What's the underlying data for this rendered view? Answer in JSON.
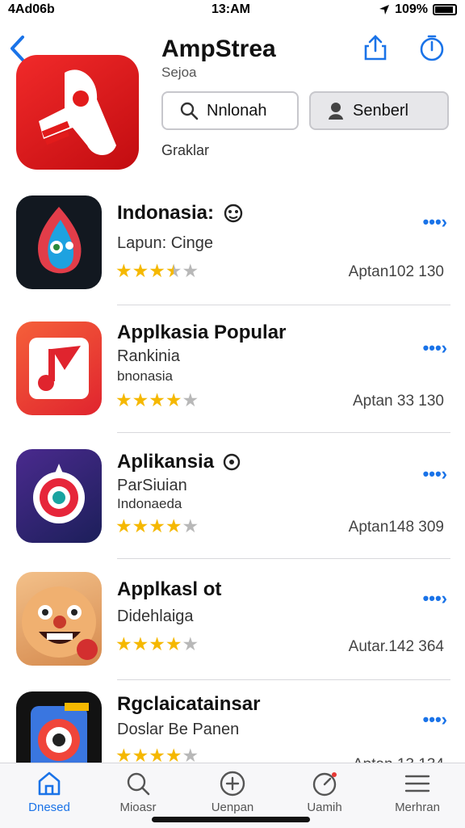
{
  "status_bar": {
    "carrier": "4Ad06b",
    "time": "13:AM",
    "battery": "109%"
  },
  "header": {
    "title": "AmpStrea",
    "subtitle": "Sejoa",
    "search_button": "Nnlonah",
    "second_button": "Senberl",
    "category": "Graklar"
  },
  "apps": [
    {
      "title": "Indonasia:",
      "line1": "Lapun: Cinge",
      "line2": "",
      "rating": 3.5,
      "count": "Aptan102 130",
      "badge": "emoji"
    },
    {
      "title": "Applkasia Popular",
      "line1": "Rankinia",
      "line2": "bnonasia",
      "rating": 4,
      "count": "Aptan 33 130",
      "badge": ""
    },
    {
      "title": "Aplikansia",
      "line1": "ParSiuian",
      "line2": "Indonaeda",
      "rating": 4,
      "count": "Aptan148 309",
      "badge": "circle"
    },
    {
      "title": "Applkasl ot",
      "line1": "Didehlaiga",
      "line2": "",
      "rating": 4,
      "count": "Autar.142 364",
      "badge": ""
    },
    {
      "title": "Rgclaicatainsar",
      "line1": "Doslar Be Panen",
      "line2": "",
      "rating": 4,
      "count": "Aptan 13 134",
      "badge": ""
    }
  ],
  "tabs": [
    {
      "label": "Dnesed",
      "icon": "home-icon",
      "active": true
    },
    {
      "label": "Mioasr",
      "icon": "search-icon",
      "active": false
    },
    {
      "label": "Uenpan",
      "icon": "plus-circle-icon",
      "active": false
    },
    {
      "label": "Uamih",
      "icon": "gauge-icon",
      "active": false
    },
    {
      "label": "Merhran",
      "icon": "menu-icon",
      "active": false
    }
  ],
  "colors": {
    "accent": "#1a73e8",
    "star": "#f5b800",
    "hero_red": "#e21b1b"
  }
}
